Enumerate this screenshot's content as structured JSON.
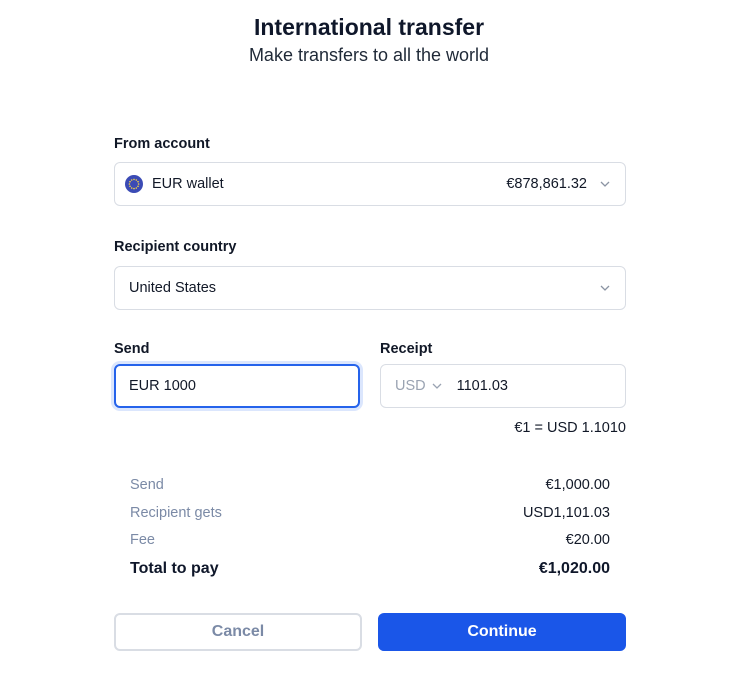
{
  "header": {
    "title": "International transfer",
    "subtitle": "Make transfers to all the world"
  },
  "from_account": {
    "label": "From account",
    "wallet_name": "EUR wallet",
    "balance": "€878,861.32",
    "flag_icon": "eu-flag-icon"
  },
  "recipient_country": {
    "label": "Recipient country",
    "value": "United States"
  },
  "send": {
    "label": "Send",
    "value": "EUR 1000"
  },
  "receipt": {
    "label": "Receipt",
    "currency": "USD",
    "value": "1101.03"
  },
  "exchange_rate": "€1 = USD 1.1010",
  "summary": [
    {
      "label": "Send",
      "value": "€1,000.00"
    },
    {
      "label": "Recipient gets",
      "value": "USD1,101.03"
    },
    {
      "label": "Fee",
      "value": "€20.00"
    },
    {
      "label": "Total to pay",
      "value": "€1,020.00"
    }
  ],
  "buttons": {
    "cancel": "Cancel",
    "continue": "Continue"
  },
  "colors": {
    "primary": "#1a56e8",
    "focus_ring": "#2563eb",
    "muted_text": "#7b8aa6",
    "border": "#d9dde4"
  }
}
